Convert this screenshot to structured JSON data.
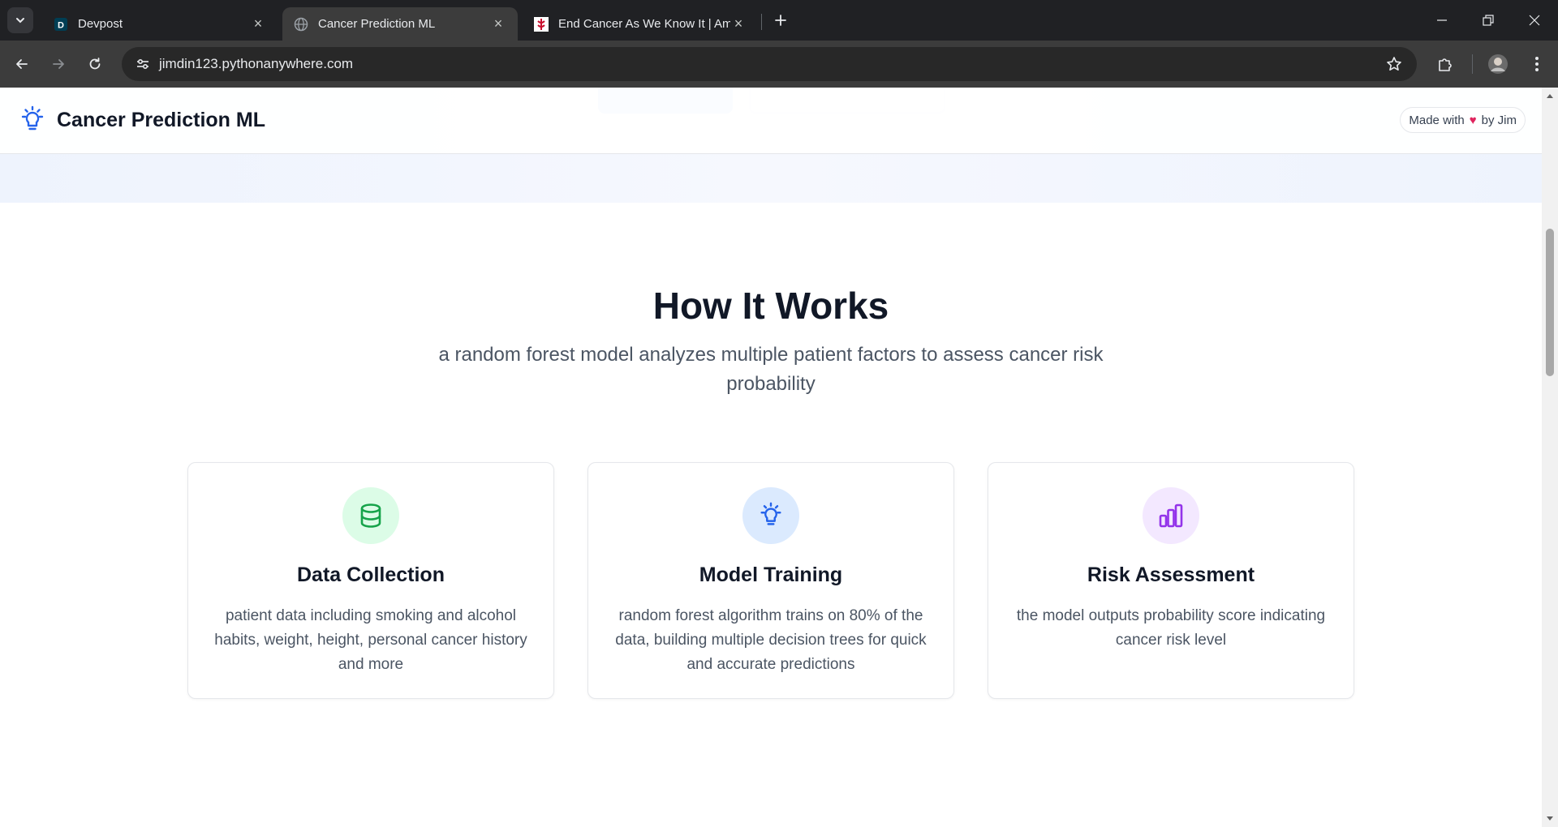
{
  "browser": {
    "tabs": [
      {
        "favicon": "devpost-icon",
        "favicon_letter": "D",
        "title": "Devpost",
        "active": false
      },
      {
        "favicon": "globe-icon",
        "title": "Cancer Prediction ML",
        "active": true
      },
      {
        "favicon": "acs-logo-icon",
        "title": "End Cancer As We Know It | Am",
        "active": false
      }
    ],
    "url": "jimdin123.pythonanywhere.com"
  },
  "header": {
    "brand_icon": "lightbulb-icon",
    "brand_name": "Cancer Prediction ML",
    "made_with_prefix": "Made with",
    "made_with_heart": "♥",
    "made_with_suffix": "by Jim"
  },
  "how_it_works": {
    "title": "How It Works",
    "subtitle": "a random forest model analyzes multiple patient factors to assess cancer risk probability",
    "cards": [
      {
        "icon": "database-icon",
        "icon_color": "#16a34a",
        "icon_bg": "#dcfce7",
        "title": "Data Collection",
        "description": "patient data including smoking and alcohol habits, weight, height, personal cancer history and more"
      },
      {
        "icon": "lightbulb-icon",
        "icon_color": "#2563eb",
        "icon_bg": "#dbeafe",
        "title": "Model Training",
        "description": "random forest algorithm trains on 80% of the data, building multiple decision trees for quick and accurate predictions"
      },
      {
        "icon": "bar-chart-icon",
        "icon_color": "#9333ea",
        "icon_bg": "#f3e8ff",
        "title": "Risk Assessment",
        "description": "the model outputs probability score indicating cancer risk level"
      }
    ]
  },
  "colors": {
    "accent": "#2563eb",
    "heart": "#e0245e"
  }
}
